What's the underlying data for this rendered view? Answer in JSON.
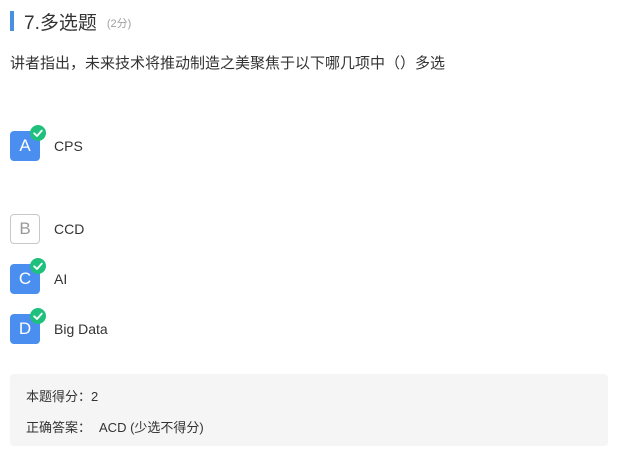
{
  "question": {
    "title": "7.多选题",
    "score": "(2分)",
    "text": "讲者指出，未来技术将推动制造之美聚焦于以下哪几项中（）多选"
  },
  "options": [
    {
      "letter": "A",
      "text": "CPS",
      "selected": true
    },
    {
      "letter": "B",
      "text": "CCD",
      "selected": false
    },
    {
      "letter": "C",
      "text": "AI",
      "selected": true
    },
    {
      "letter": "D",
      "text": "Big Data",
      "selected": true
    }
  ],
  "answer": {
    "score_label": "本题得分：",
    "score_value": "2",
    "correct_label": "正确答案：",
    "correct_value": "ACD (少选不得分)"
  },
  "colors": {
    "accent": "#4a8ff0",
    "check": "#1fc07e",
    "answer_bg": "#f5f5f5"
  },
  "icons": {
    "check": "check-circle-icon"
  }
}
